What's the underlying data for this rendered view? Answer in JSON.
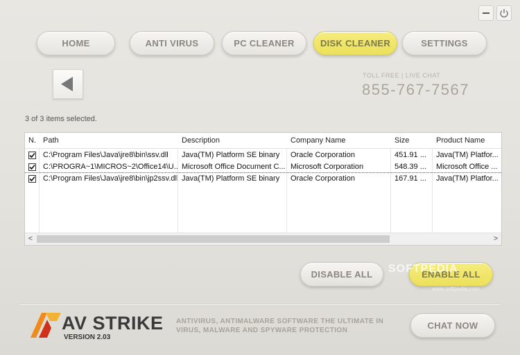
{
  "window": {
    "minimize_icon": "minus-icon",
    "close_icon": "power-icon"
  },
  "nav": {
    "tabs": [
      {
        "label": "HOME",
        "active": false
      },
      {
        "label": "ANTI VIRUS",
        "active": false
      },
      {
        "label": "PC CLEANER",
        "active": false
      },
      {
        "label": "DISK CLEANER",
        "active": true
      },
      {
        "label": "SETTINGS",
        "active": false
      }
    ]
  },
  "header": {
    "back_icon": "back-arrow-icon",
    "toll_free_label": "TOLL FREE | LIVE CHAT",
    "phone": "855-767-7567"
  },
  "grid": {
    "selection_text": "3 of 3 items selected.",
    "columns": [
      "N.",
      "Path",
      "Description",
      "Company Name",
      "Size",
      "Product Name"
    ],
    "rows": [
      {
        "checked": true,
        "path": "C:\\Program Files\\Java\\jre8\\bin\\ssv.dll",
        "description": "Java(TM) Platform SE binary",
        "company": "Oracle Corporation",
        "size": "451.91 ...",
        "product": "Java(TM) Platfor..."
      },
      {
        "checked": true,
        "path": "C:\\PROGRA~1\\MICROS~2\\Office14\\U...",
        "description": "Microsoft Office Document C...",
        "company": "Microsoft Corporation",
        "size": "548.39 ...",
        "product": "Microsoft Office ..."
      },
      {
        "checked": true,
        "path": "C:\\Program Files\\Java\\jre8\\bin\\jp2ssv.dll",
        "description": "Java(TM) Platform SE binary",
        "company": "Oracle Corporation",
        "size": "167.91 ...",
        "product": "Java(TM) Platfor..."
      }
    ],
    "scroll_left": "<",
    "scroll_right": ">"
  },
  "actions": {
    "disable_all": "DISABLE ALL",
    "enable_all": "ENABLE ALL"
  },
  "footer": {
    "brand_av": "AV",
    "brand_strike": "STRIKE",
    "version": "VERSION 2.03",
    "tagline": "ANTIVIRUS, ANTIMALWARE SOFTWARE THE ULTIMATE IN VIRUS, MALWARE AND SPYWARE PROTECTION",
    "chat_now": "CHAT NOW"
  },
  "watermark": {
    "text": "SOFTPEDIA",
    "url": "www.softpedia.com"
  },
  "colors": {
    "accent_yellow": "#ece05a",
    "logo_orange": "#f08a1c",
    "logo_red": "#d0301a",
    "background": "#e6e4df"
  }
}
